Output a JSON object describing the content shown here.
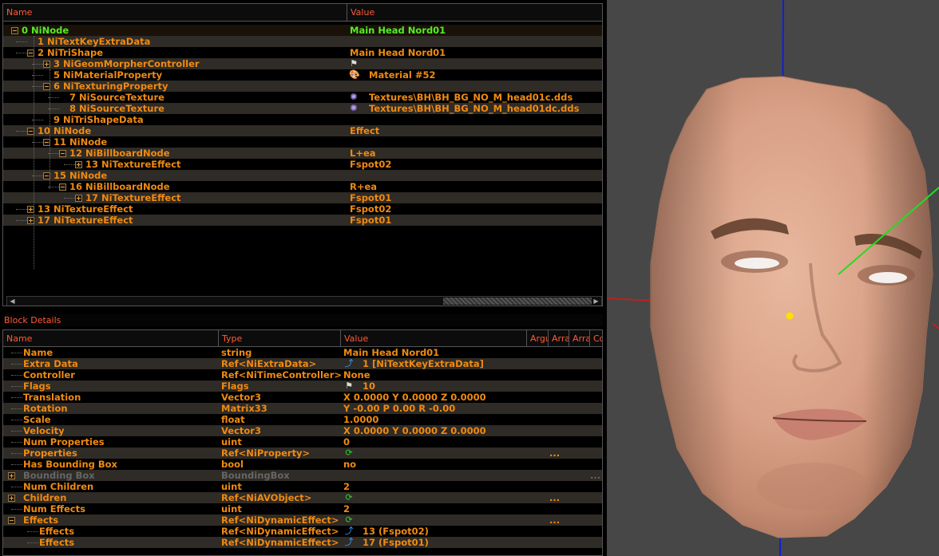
{
  "tree": {
    "columns": {
      "name": "Name",
      "value": "Value"
    },
    "rows": [
      {
        "name": "0 NiNode",
        "value": "Main Head Nord01",
        "indent": 0,
        "toggle": "minus",
        "green": true
      },
      {
        "name": "1 NiTextKeyExtraData",
        "value": "",
        "indent": 1,
        "toggle": "none"
      },
      {
        "name": "2 NiTriShape",
        "value": "Main Head Nord01",
        "indent": 1,
        "toggle": "minus"
      },
      {
        "name": "3 NiGeomMorpherController",
        "value": "",
        "indent": 2,
        "toggle": "plus",
        "icon": "flag-icon"
      },
      {
        "name": "5 NiMaterialProperty",
        "value": "Material #52",
        "indent": 2,
        "toggle": "none",
        "icon": "palette-icon"
      },
      {
        "name": "6 NiTexturingProperty",
        "value": "",
        "indent": 2,
        "toggle": "minus"
      },
      {
        "name": "7 NiSourceTexture",
        "value": "Textures\\BH\\BH_BG_NO_M_head01c.dds",
        "indent": 3,
        "toggle": "none",
        "icon": "texture-icon"
      },
      {
        "name": "8 NiSourceTexture",
        "value": "Textures\\BH\\BH_BG_NO_M_head01dc.dds",
        "indent": 3,
        "toggle": "none",
        "icon": "texture-icon"
      },
      {
        "name": "9 NiTriShapeData",
        "value": "",
        "indent": 2,
        "toggle": "none"
      },
      {
        "name": "10 NiNode",
        "value": "Effect",
        "indent": 1,
        "toggle": "minus"
      },
      {
        "name": "11 NiNode",
        "value": "",
        "indent": 2,
        "toggle": "minus"
      },
      {
        "name": "12 NiBillboardNode",
        "value": "L+ea",
        "indent": 3,
        "toggle": "minus"
      },
      {
        "name": "13 NiTextureEffect",
        "value": "Fspot02",
        "indent": 4,
        "toggle": "plus"
      },
      {
        "name": "15 NiNode",
        "value": "",
        "indent": 2,
        "toggle": "minus"
      },
      {
        "name": "16 NiBillboardNode",
        "value": "R+ea",
        "indent": 3,
        "toggle": "minus"
      },
      {
        "name": "17 NiTextureEffect",
        "value": "Fspot01",
        "indent": 4,
        "toggle": "plus"
      },
      {
        "name": "13 NiTextureEffect",
        "value": "Fspot02",
        "indent": 1,
        "toggle": "plus"
      },
      {
        "name": "17 NiTextureEffect",
        "value": "Fspot01",
        "indent": 1,
        "toggle": "plus"
      }
    ]
  },
  "details": {
    "title": "Block Details",
    "columns": {
      "name": "Name",
      "type": "Type",
      "value": "Value",
      "arg": "Argu",
      "arr1": "Arra",
      "arr2": "Arra",
      "cond": "Co"
    },
    "rows": [
      {
        "name": "Name",
        "type": "string",
        "value": "Main Head Nord01",
        "indent": 1
      },
      {
        "name": "Extra Data",
        "type": "Ref<NiExtraData>",
        "value": "1 [NiTextKeyExtraData]",
        "indent": 1,
        "icon": "link-icon"
      },
      {
        "name": "Controller",
        "type": "Ref<NiTimeController>",
        "value": "None",
        "indent": 1
      },
      {
        "name": "Flags",
        "type": "Flags",
        "value": "10",
        "indent": 1,
        "icon": "flag-icon"
      },
      {
        "name": "Translation",
        "type": "Vector3",
        "value": "X 0.0000 Y 0.0000 Z 0.0000",
        "indent": 1
      },
      {
        "name": "Rotation",
        "type": "Matrix33",
        "value": "Y -0.00 P 0.00 R -0.00",
        "indent": 1
      },
      {
        "name": "Scale",
        "type": "float",
        "value": "1.0000",
        "indent": 1
      },
      {
        "name": "Velocity",
        "type": "Vector3",
        "value": "X 0.0000 Y 0.0000 Z 0.0000",
        "indent": 1
      },
      {
        "name": "Num Properties",
        "type": "uint",
        "value": "0",
        "indent": 1
      },
      {
        "name": "Properties",
        "type": "Ref<NiProperty>",
        "value": "",
        "indent": 1,
        "icon": "array-icon",
        "extra": "..."
      },
      {
        "name": "Has Bounding Box",
        "type": "bool",
        "value": "no",
        "indent": 1
      },
      {
        "name": "Bounding Box",
        "type": "BoundingBox",
        "value": "",
        "indent": 1,
        "toggle": "plus",
        "gray": true,
        "extra": "..."
      },
      {
        "name": "Num Children",
        "type": "uint",
        "value": "2",
        "indent": 1
      },
      {
        "name": "Children",
        "type": "Ref<NiAVObject>",
        "value": "",
        "indent": 1,
        "toggle": "plus",
        "icon": "array-icon",
        "extra": "..."
      },
      {
        "name": "Num Effects",
        "type": "uint",
        "value": "2",
        "indent": 1
      },
      {
        "name": "Effects",
        "type": "Ref<NiDynamicEffect>",
        "value": "",
        "indent": 1,
        "toggle": "minus",
        "icon": "array-icon",
        "extra": "..."
      },
      {
        "name": "Effects",
        "type": "Ref<NiDynamicEffect>",
        "value": "13 (Fspot02)",
        "indent": 2,
        "icon": "link-icon"
      },
      {
        "name": "Effects",
        "type": "Ref<NiDynamicEffect>",
        "value": "17 (Fspot01)",
        "indent": 2,
        "icon": "link-icon"
      }
    ]
  },
  "colors": {
    "accent": "#f08a10",
    "header": "#ff5a36",
    "selected": "#55ee22",
    "stripe": "#2f2b26"
  }
}
